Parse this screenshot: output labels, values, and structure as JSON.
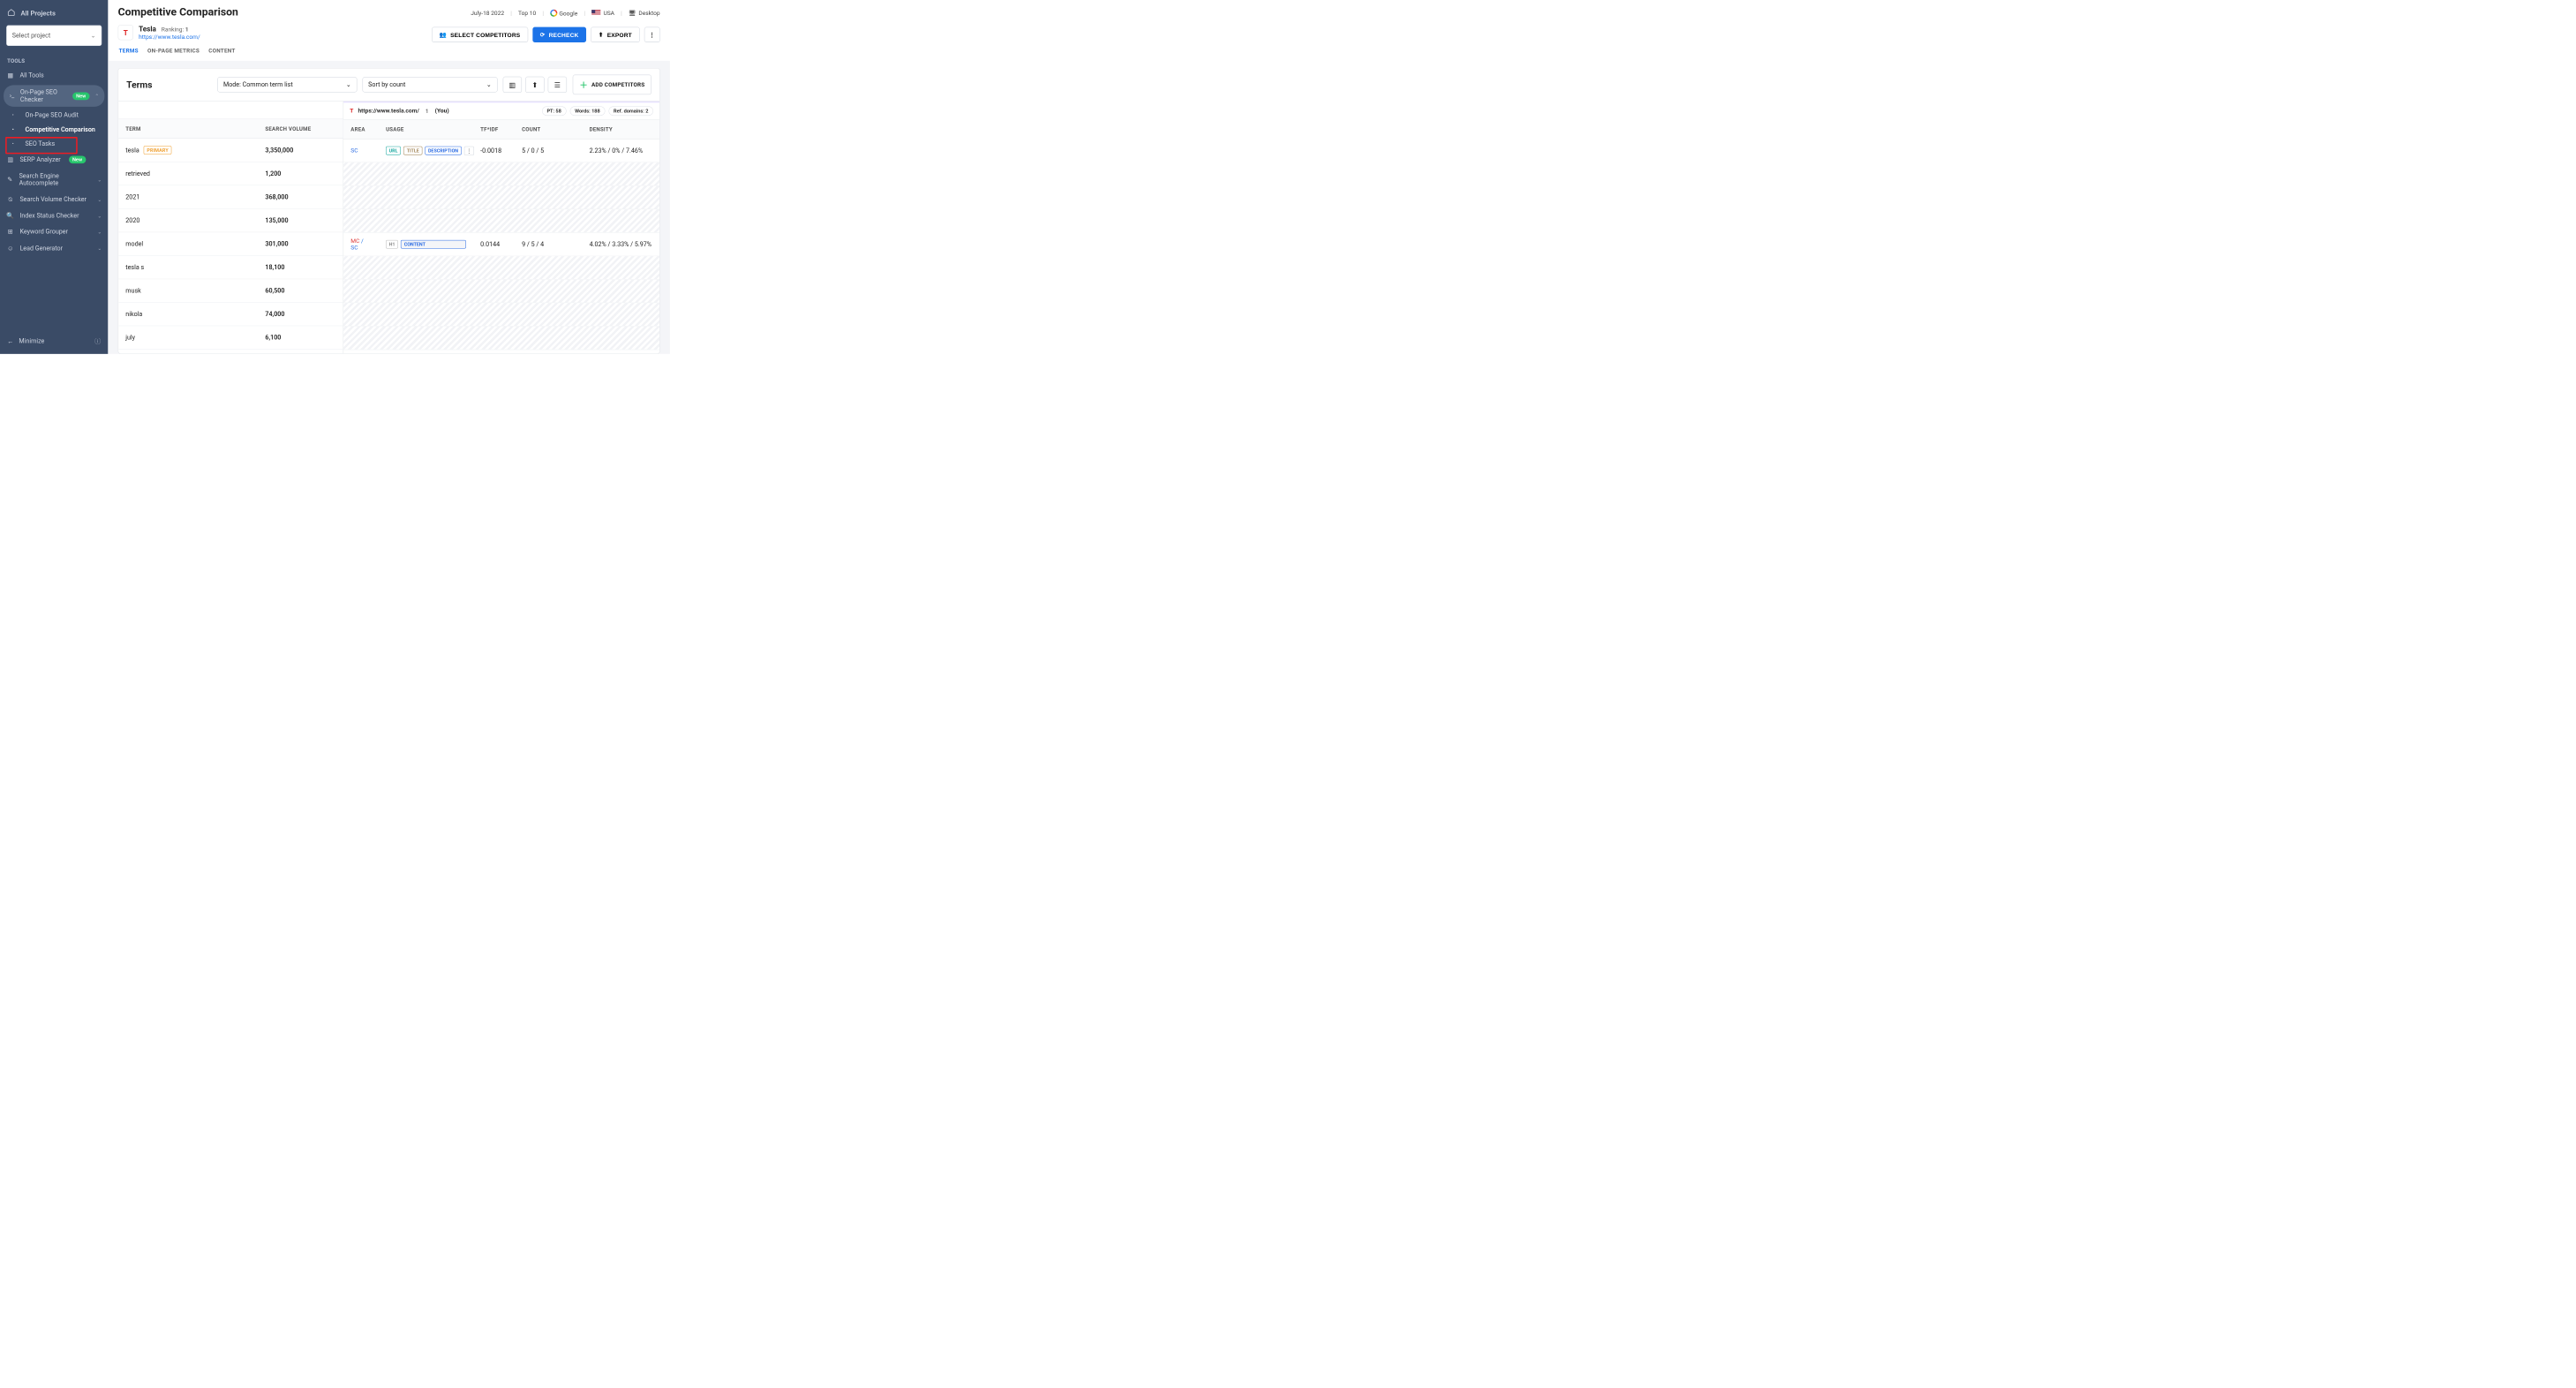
{
  "sidebar": {
    "all_projects": "All Projects",
    "select_project_placeholder": "Select project",
    "section_label": "TOOLS",
    "items": {
      "all_tools": "All Tools",
      "onpage_checker": "On-Page SEO Checker",
      "onpage_audit": "On-Page SEO Audit",
      "competitive_comparison": "Competitive Comparison",
      "seo_tasks": "SEO Tasks",
      "serp_analyzer": "SERP Analyzer",
      "se_autocomplete": "Search Engine Autocomplete",
      "sv_checker": "Search Volume Checker",
      "index_status": "Index Status Checker",
      "keyword_grouper": "Keyword Grouper",
      "lead_generator": "Lead Generator"
    },
    "new_badge": "New",
    "minimize": "Minimize"
  },
  "header": {
    "title": "Competitive Comparison",
    "project": {
      "name": "Tesla",
      "ranking_label": "Ranking:",
      "ranking_value": "1",
      "url": "https://www.tesla.com/"
    },
    "filters": {
      "date": "July-18 2022",
      "top": "Top 10",
      "engine": "Google",
      "country": "USA",
      "device": "Desktop"
    },
    "actions": {
      "select_competitors": "SELECT COMPETITORS",
      "recheck": "RECHECK",
      "export": "EXPORT"
    },
    "tabs": {
      "terms": "TERMS",
      "onpage": "ON-PAGE METRICS",
      "content": "CONTENT"
    }
  },
  "panel": {
    "title": "Terms",
    "mode": "Mode: Common term list",
    "sort": "Sort by count",
    "add_competitors": "ADD COMPETITORS"
  },
  "right_header": {
    "url": "https://www.tesla.com/",
    "index": "1",
    "you": "(You)",
    "pt_label": "PT:",
    "pt_value": "58",
    "words_label": "Words:",
    "words_value": "188",
    "refd_label": "Ref. domains:",
    "refd_value": "2"
  },
  "columns": {
    "term": "TERM",
    "sv": "SEARCH VOLUME",
    "area": "AREA",
    "usage": "USAGE",
    "tfidf": "TF*IDF",
    "count": "COUNT",
    "density": "DENSITY"
  },
  "terms": [
    {
      "term": "tesla",
      "primary": true,
      "sv": "3,350,000",
      "area": "SC",
      "usage": [
        "URL",
        "TITLE",
        "DESCRIPTION"
      ],
      "tfidf": "-0.0018",
      "count": "5 / 0 / 5",
      "density": "2.23% / 0% / 7.46%"
    },
    {
      "term": "retrieved",
      "sv": "1,200"
    },
    {
      "term": "2021",
      "sv": "368,000"
    },
    {
      "term": "2020",
      "sv": "135,000"
    },
    {
      "term": "model",
      "sv": "301,000",
      "area": "MC / SC",
      "usage": [
        "H1",
        "CONTENT"
      ],
      "tfidf": "0.0144",
      "count": "9 / 5 / 4",
      "density": "4.02% / 3.33% / 5.97%"
    },
    {
      "term": "tesla s",
      "sv": "18,100"
    },
    {
      "term": "musk",
      "sv": "60,500"
    },
    {
      "term": "nikola",
      "sv": "74,000"
    },
    {
      "term": "july",
      "sv": "6,100"
    }
  ]
}
